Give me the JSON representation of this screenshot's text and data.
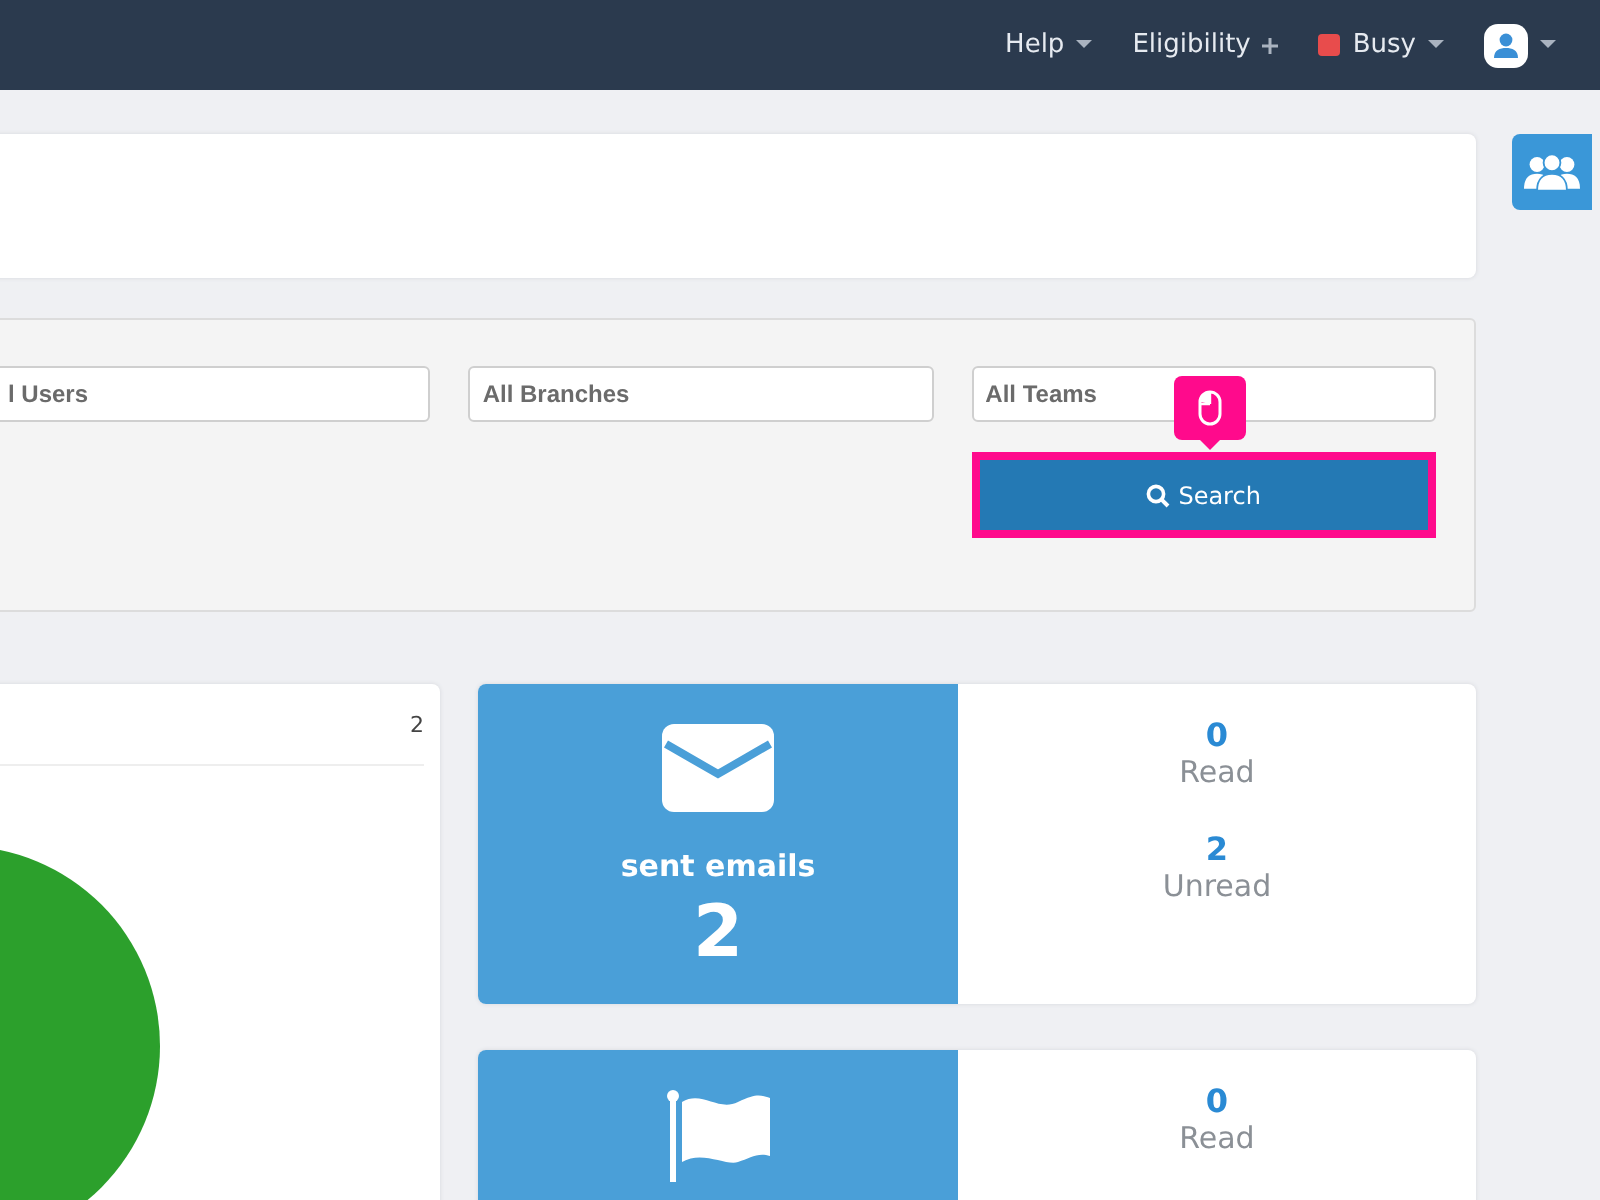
{
  "topbar": {
    "menus": [
      {
        "label": "Help",
        "kind": "caret"
      },
      {
        "label": "Eligibility",
        "kind": "plus"
      },
      {
        "label": "Busy",
        "kind": "status",
        "color": "#e84c4c"
      }
    ]
  },
  "filters": {
    "fields": [
      {
        "value": "l Users"
      },
      {
        "value": "All Branches"
      },
      {
        "value": "All Teams"
      }
    ],
    "search_button": {
      "label": "Search",
      "highlighted": true
    }
  },
  "chart_card": {
    "count": "2"
  },
  "stats": [
    {
      "kind": "email",
      "title": "sent emails",
      "total": "2",
      "metrics": [
        {
          "value": "0",
          "label": "Read"
        },
        {
          "value": "2",
          "label": "Unread"
        }
      ]
    },
    {
      "kind": "flag",
      "metrics": [
        {
          "value": "0",
          "label": "Read"
        }
      ]
    }
  ]
}
